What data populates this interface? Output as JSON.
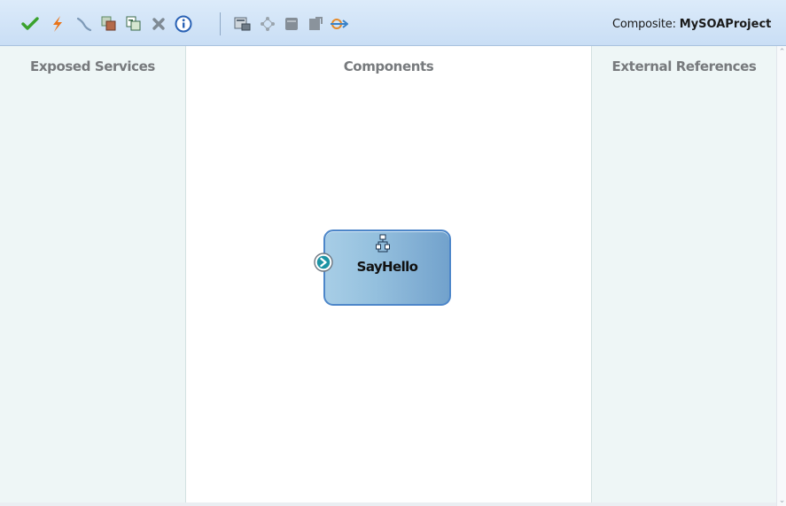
{
  "toolbar": {
    "icons": [
      "validate-checkmark-icon",
      "lightning-icon",
      "wire-icon",
      "copy-icon",
      "paste-icon",
      "delete-icon",
      "info-icon",
      "deploy-icon",
      "test-icon",
      "database-icon",
      "task-icon",
      "mediator-icon"
    ],
    "composite_label": "Composite:",
    "composite_name": "MySOAProject"
  },
  "lanes": {
    "exposed_services": {
      "title": "Exposed Services"
    },
    "components": {
      "title": "Components"
    },
    "external_references": {
      "title": "External References"
    }
  },
  "component": {
    "name": "SayHello",
    "icon": "bpel-process-icon",
    "port_icon": "service-port-icon"
  },
  "colors": {
    "toolbar_bg": "#c9def5",
    "lane_bg": "#eef6f6",
    "component_border": "#4d86c9",
    "component_fill": "#8ab6d8",
    "port_fill": "#1c93a4"
  }
}
